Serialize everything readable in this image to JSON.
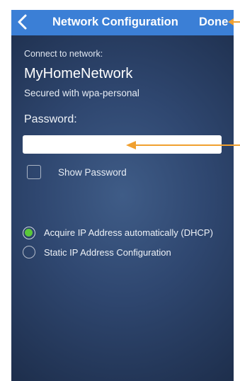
{
  "colors": {
    "navbar_bg": "#3b7fd6",
    "screen_bg": "#2f4770",
    "radio_selected": "#5ac839",
    "annotation_arrow": "#f0a030"
  },
  "navbar": {
    "back_icon": "chevron-left-icon",
    "title": "Network Configuration",
    "done_label": "Done"
  },
  "network": {
    "connect_label": "Connect to network:",
    "name": "MyHomeNetwork",
    "security": "Secured with wpa-personal"
  },
  "password": {
    "label": "Password:",
    "value": "",
    "show_label": "Show Password",
    "show_checked": false
  },
  "ip_options": [
    {
      "label": "Acquire IP Address automatically (DHCP)",
      "selected": true
    },
    {
      "label": "Static IP Address Configuration",
      "selected": false
    }
  ]
}
